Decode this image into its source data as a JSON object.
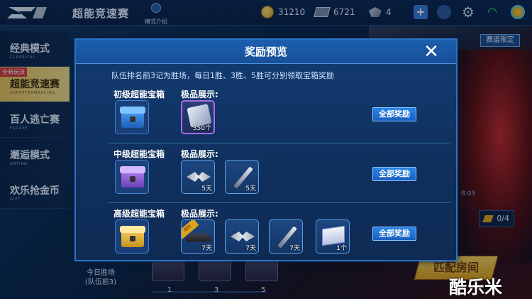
{
  "header": {
    "title": "超能竞速赛",
    "mode_intro_label": "模式介绍",
    "coins": "31210",
    "tickets": "6721",
    "gems": "4"
  },
  "sidebar": {
    "items": [
      {
        "label": "经典模式",
        "sub": "CLASSICAL",
        "active": false
      },
      {
        "label": "超能竞速赛",
        "sub": "SUPERTEAMRACING",
        "active": true,
        "badge": "全新玩法"
      },
      {
        "label": "百人逃亡赛",
        "sub": "ESCAPE",
        "active": false
      },
      {
        "label": "邂逅模式",
        "sub": "DATING",
        "active": false
      },
      {
        "label": "欢乐抢金币",
        "sub": "GIFT",
        "active": false
      }
    ]
  },
  "background": {
    "track_limit": "赛道限定",
    "stat_text": "8.05",
    "cup_progress": "0/4",
    "today_win": "今日胜场",
    "today_win_sub": "(队伍前3)",
    "progress_marks": [
      "1",
      "3",
      "5"
    ],
    "match_button": "匹配房间",
    "watermark": "酷乐米"
  },
  "modal": {
    "title": "奖励预览",
    "close_icon": "close-icon",
    "rule": "队伍排名前3记为胜场，每日1胜、3胜、5胜可分别领取宝箱奖励",
    "showcase_label": "极品展示:",
    "all_rewards_label": "全部奖励",
    "tiers": [
      {
        "name": "初级超能宝箱",
        "chest_color": "blue",
        "items": [
          {
            "icon": "card-icon",
            "qty": "350个",
            "rarity": "purple"
          }
        ]
      },
      {
        "name": "中级超能宝箱",
        "chest_color": "purple",
        "items": [
          {
            "icon": "wing-icon",
            "qty": "5天",
            "rarity": "blue"
          },
          {
            "icon": "sword-icon",
            "qty": "5天",
            "rarity": "blue"
          }
        ]
      },
      {
        "name": "高级超能宝箱",
        "chest_color": "gold",
        "items": [
          {
            "icon": "car-icon",
            "qty": "7天",
            "rarity": "blue",
            "ribbon": "限时"
          },
          {
            "icon": "wing-icon",
            "qty": "7天",
            "rarity": "blue"
          },
          {
            "icon": "sword-icon",
            "qty": "7天",
            "rarity": "blue"
          },
          {
            "icon": "crate-icon",
            "qty": "1个",
            "rarity": "blue"
          }
        ]
      }
    ]
  }
}
